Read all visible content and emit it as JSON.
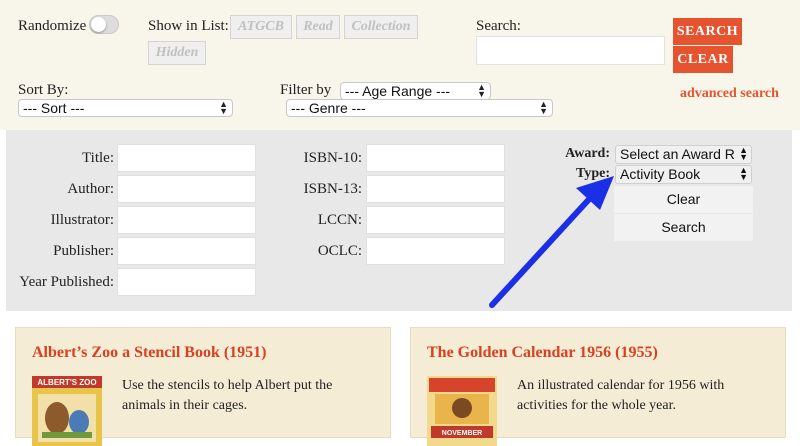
{
  "top": {
    "randomize_label": "Randomize",
    "show_in_list_label": "Show in List:",
    "list_chips": [
      "ATGCB",
      "Read",
      "Collection",
      "Hidden"
    ],
    "search_label": "Search:",
    "search_value": "",
    "search_button": "SEARCH",
    "clear_button": "CLEAR",
    "advanced_link": "advanced search",
    "sort_by_label": "Sort By:",
    "sort_select": "--- Sort ---",
    "filter_by_label": "Filter by",
    "age_select": "--- Age Range ---",
    "genre_select": "--- Genre ---"
  },
  "advanced": {
    "left_fields": [
      "Title:",
      "Author:",
      "Illustrator:",
      "Publisher:",
      "Year Published:"
    ],
    "mid_fields": [
      "ISBN-10:",
      "ISBN-13:",
      "LCCN:",
      "OCLC:"
    ],
    "award_label": "Award:",
    "award_select": "Select an Award R",
    "type_label": "Type:",
    "type_select": "Activity Book",
    "clear_button": "Clear",
    "search_button": "Search"
  },
  "cards": [
    {
      "title": "Albert’s Zoo a Stencil Book (1951)",
      "description": "Use the stencils to help Albert put the animals in their cages.",
      "thumb_text": "ALBERT'S ZOO"
    },
    {
      "title": "The Golden Calendar 1956 (1955)",
      "description": "An illustrated calendar for 1956 with activities for the whole year.",
      "thumb_text": "NOVEMBER"
    }
  ],
  "colors": {
    "accent": "#e5532f",
    "title_red": "#d8401f",
    "arrow_blue": "#1a2fe6",
    "top_bg": "#f8f6ea",
    "panel_bg": "#e8e8e8",
    "card_bg": "#f5ecd6"
  }
}
